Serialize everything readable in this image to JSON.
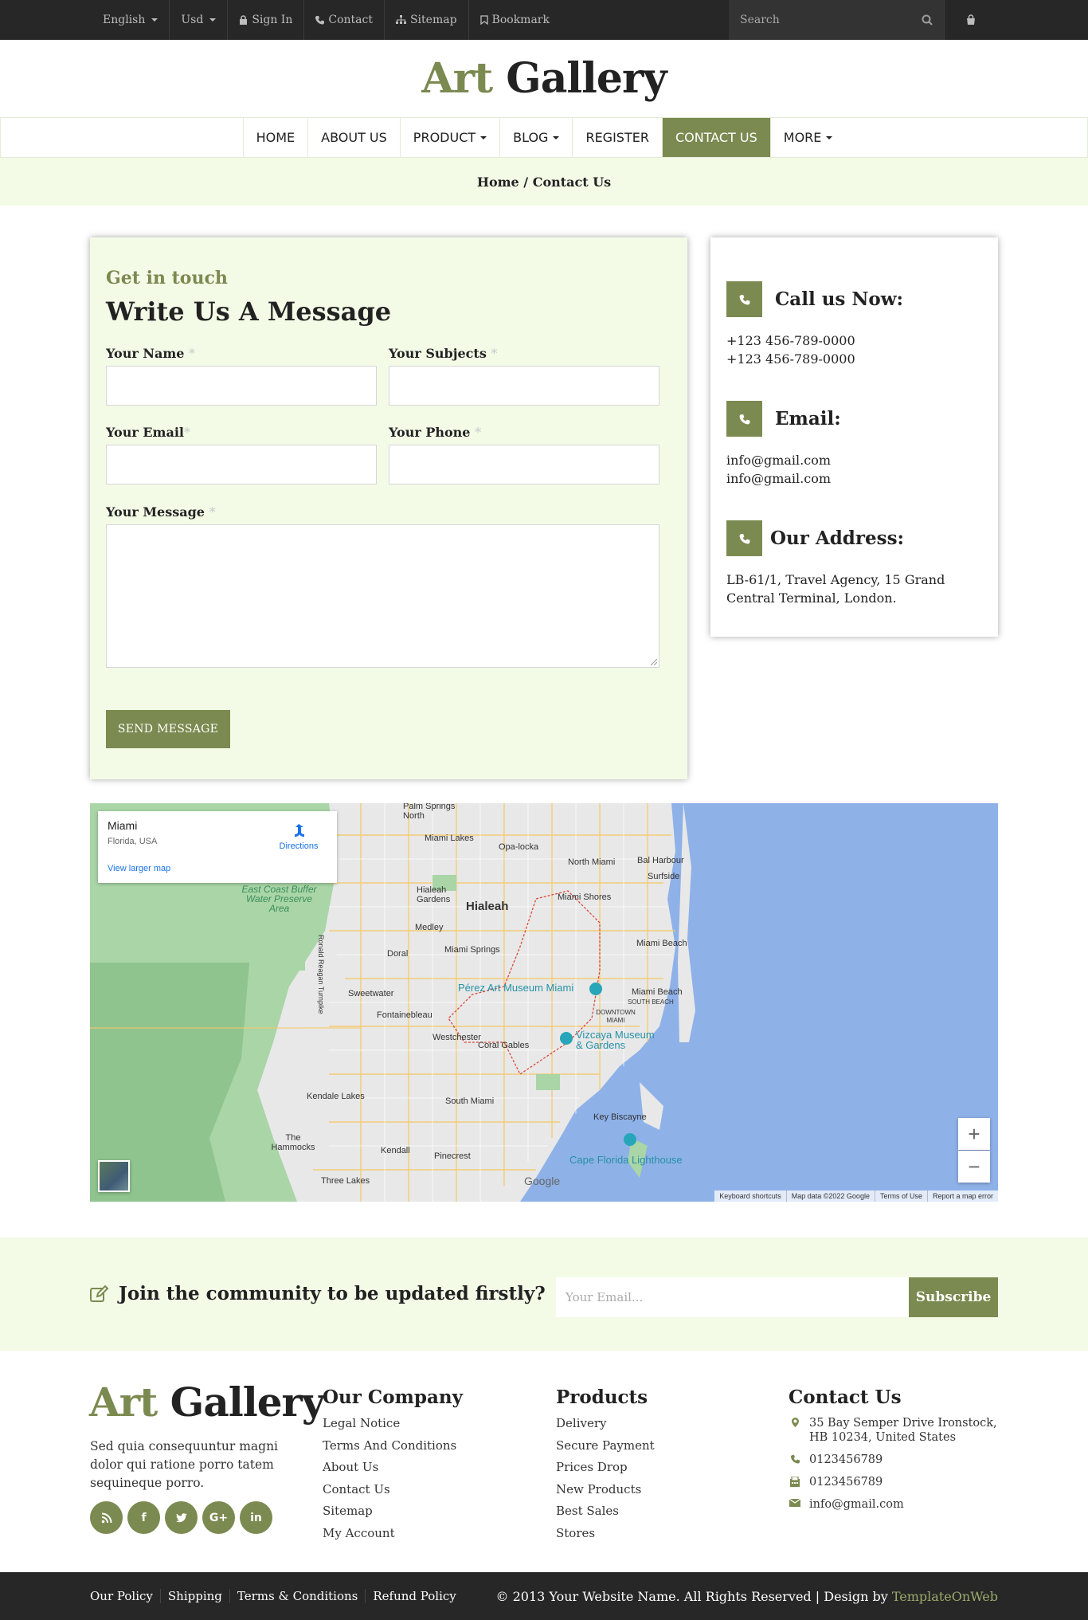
{
  "topbar": {
    "language": "English",
    "currency": "Usd",
    "sign_in": "Sign In",
    "contact": "Contact",
    "sitemap": "Sitemap",
    "bookmark": "Bookmark",
    "search_placeholder": "Search"
  },
  "logo": {
    "part1": "Art",
    "part2": "Gallery"
  },
  "nav": {
    "home": "HOME",
    "about": "ABOUT US",
    "product": "PRODUCT",
    "blog": "BLOG",
    "register": "REGISTER",
    "contact": "CONTACT US",
    "more": "MORE"
  },
  "breadcrumb": "Home / Contact Us",
  "form": {
    "eyebrow": "Get in touch",
    "title": "Write Us A Message",
    "name_label": "Your Name",
    "subjects_label": "Your Subjects",
    "email_label": "Your Email",
    "phone_label": "Your Phone",
    "message_label": "Your Message",
    "required_mark": "*",
    "send_label": "SEND MESSAGE"
  },
  "info": {
    "call_title": "Call us Now:",
    "phones": [
      "+123 456-789-0000",
      "+123 456-789-0000"
    ],
    "email_title": "Email:",
    "emails": [
      "info@gmail.com",
      "info@gmail.com"
    ],
    "address_title": "Our Address:",
    "address_lines": [
      "LB-61/1, Travel Agency, 15 Grand",
      "Central Terminal, London."
    ]
  },
  "map": {
    "place_title": "Miami",
    "place_sub": "Florida, USA",
    "view_larger": "View larger map",
    "directions": "Directions",
    "zoom_in": "+",
    "zoom_out": "−",
    "google": "Google",
    "footer_links": [
      "Keyboard shortcuts",
      "Map data ©2022 Google",
      "Terms of Use",
      "Report a map error"
    ],
    "labels": {
      "hialeah": "Hialeah",
      "miami_lakes": "Miami Lakes",
      "opa_locka": "Opa-locka",
      "north_miami": "North Miami",
      "bal_harbour": "Bal Harbour",
      "surfside": "Surfside",
      "miami_shores": "Miami Shores",
      "hialeah_gardens": "Hialeah Gardens",
      "medley": "Medley",
      "miami_springs": "Miami Springs",
      "doral": "Doral",
      "miami_beach": "Miami Beach",
      "sweetwater": "Sweetwater",
      "fontainebleau": "Fontainebleau",
      "perez": "Pérez Art Museum Miami",
      "miami_beach2": "Miami Beach",
      "south_beach": "SOUTH BEACH",
      "downtown": "DOWNTOWN MIAMI",
      "westchester": "Westchester",
      "coral_gables": "Coral Gables",
      "vizcaya": "Vizcaya Museum & Gardens",
      "kendale_lakes": "Kendale Lakes",
      "south_miami": "South Miami",
      "key_biscayne": "Key Biscayne",
      "the_hammocks": "The Hammocks",
      "kendall": "Kendall",
      "pinecrest": "Pinecrest",
      "cape_florida": "Cape Florida Lighthouse",
      "three_lakes": "Three Lakes",
      "palm_springs_north": "Palm Springs North",
      "east_coast": "East Coast Buffer Water Preserve Area",
      "ronald_reagan": "Ronald Reagan Turnpike"
    }
  },
  "newsletter": {
    "text": "Join the community to be updated firstly?",
    "placeholder": "Your Email...",
    "button": "Subscribe"
  },
  "footer": {
    "about": "Sed quia consequuntur magni dolor qui ratione porro tatem sequineque porro.",
    "social": [
      "rss",
      "f",
      "t",
      "G+",
      "in"
    ],
    "company_title": "Our Company",
    "company_links": [
      "Legal Notice",
      "Terms And Conditions",
      "About Us",
      "Contact Us",
      "Sitemap",
      "My Account"
    ],
    "products_title": "Products",
    "products_links": [
      "Delivery",
      "Secure Payment",
      "Prices Drop",
      "New Products",
      "Best Sales",
      "Stores"
    ],
    "contact_title": "Contact Us",
    "contact_address": "35 Bay Semper Drive Ironstock, HB 10234, United States",
    "contact_phone": "0123456789",
    "contact_fax": "0123456789",
    "contact_email": "info@gmail.com"
  },
  "bottombar": {
    "links": [
      "Our Policy",
      "Shipping",
      "Terms & Conditions",
      "Refund Policy"
    ],
    "copyright": "© 2013 Your Website Name. All Rights Reserved | Design by ",
    "brand": "TemplateOnWeb"
  },
  "colors": {
    "accent": "#7b8a50",
    "light_green": "#f3fbe7",
    "dark": "#272727"
  }
}
